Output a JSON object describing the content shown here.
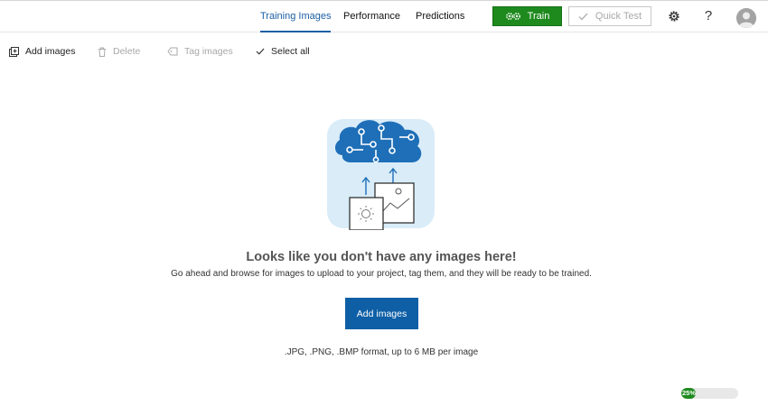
{
  "nav": {
    "tabs": [
      {
        "label": "Training Images",
        "active": true
      },
      {
        "label": "Performance",
        "active": false
      },
      {
        "label": "Predictions",
        "active": false
      }
    ],
    "train_label": "Train",
    "quick_test_label": "Quick Test",
    "settings_icon": "gear-icon",
    "help_label": "?",
    "avatar_icon": "user-avatar-icon"
  },
  "toolbar": {
    "add_images": "Add images",
    "delete": "Delete",
    "tag_images": "Tag images",
    "select_all": "Select all"
  },
  "empty_state": {
    "illustration_icon": "cloud-brain-upload-icon",
    "title": "Looks like you don't have any images here!",
    "subtitle": "Go ahead and browse for images to upload to your project, tag them, and they will be ready to be trained.",
    "button_label": "Add images",
    "format_note": ".JPG, .PNG, .BMP format, up to 6 MB per image"
  },
  "status": {
    "progress_percent": 25,
    "progress_label": "25%"
  },
  "colors": {
    "accent": "#1b5fa5",
    "train_green": "#1e8a1e",
    "cta_blue": "#0e5fa6",
    "illustration_bg": "#d9ecf8",
    "illustration_cloud": "#1e6fb8"
  }
}
